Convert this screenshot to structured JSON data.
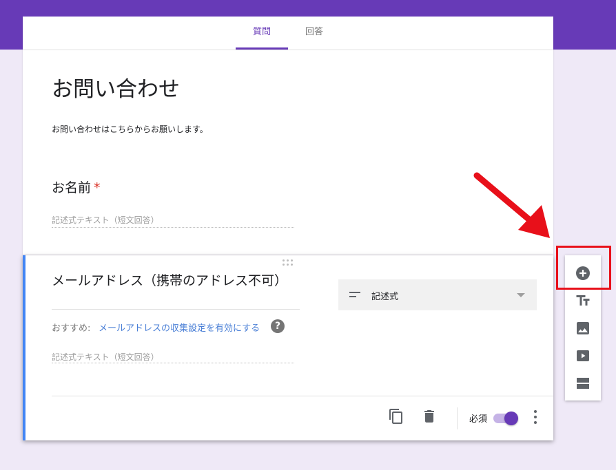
{
  "tabs": {
    "questions": "質問",
    "responses": "回答"
  },
  "form": {
    "title": "お問い合わせ",
    "description": "お問い合わせはこちらからお願いします。"
  },
  "question1": {
    "title": "お名前",
    "required_mark": "*",
    "answer_placeholder": "記述式テキスト（短文回答）"
  },
  "question2": {
    "title": "メールアドレス（携帯のアドレス不可）",
    "suggestion_prefix": "おすすめ:",
    "suggestion_link": "メールアドレスの収集設定を有効にする",
    "help_icon": "?",
    "answer_placeholder": "記述式テキスト（短文回答）",
    "type_label": "記述式",
    "required_label": "必須",
    "required_on": true
  },
  "side_toolbar": {
    "icons": [
      "add-question-icon",
      "add-title-icon",
      "add-image-icon",
      "add-video-icon",
      "add-section-icon"
    ]
  },
  "colors": {
    "theme": "#673ab7",
    "background": "#efe9f7",
    "active_indicator": "#4285f4",
    "highlight": "#e8101a",
    "link": "#4a7fd6"
  }
}
